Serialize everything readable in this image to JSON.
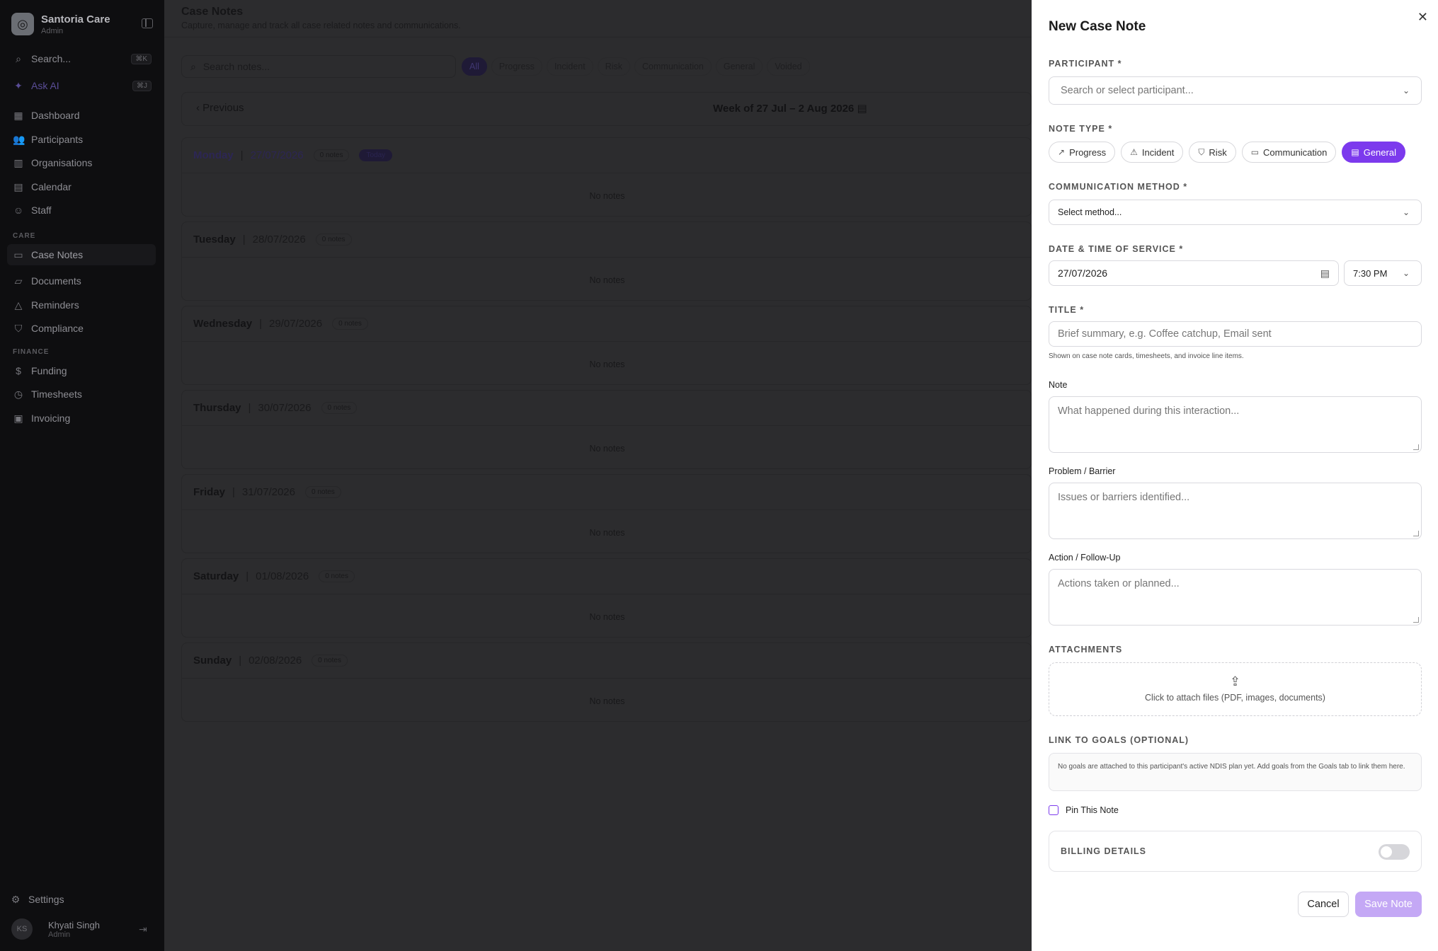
{
  "sidebar": {
    "brand_name": "Santoria Care",
    "brand_role": "Admin",
    "search_label": "Search...",
    "search_kbd": "⌘K",
    "ask_ai_label": "Ask AI",
    "ask_ai_kbd": "⌘J",
    "nav": [
      {
        "label": "Dashboard",
        "icon": "grid-icon"
      },
      {
        "label": "Participants",
        "icon": "users-icon"
      },
      {
        "label": "Organisations",
        "icon": "building-icon"
      },
      {
        "label": "Calendar",
        "icon": "calendar-icon"
      },
      {
        "label": "Staff",
        "icon": "staff-icon"
      }
    ],
    "care_label": "CARE",
    "care": [
      {
        "label": "Case Notes",
        "icon": "notes-icon",
        "active": true
      },
      {
        "label": "Documents",
        "icon": "folder-icon"
      },
      {
        "label": "Reminders",
        "icon": "bell-icon"
      },
      {
        "label": "Compliance",
        "icon": "shield-icon"
      }
    ],
    "finance_label": "FINANCE",
    "finance": [
      {
        "label": "Funding",
        "icon": "dollar-icon"
      },
      {
        "label": "Timesheets",
        "icon": "clock-icon"
      },
      {
        "label": "Invoicing",
        "icon": "invoice-icon"
      }
    ],
    "settings_label": "Settings",
    "user_initials": "KS",
    "user_name": "Khyati Singh",
    "user_role": "Admin"
  },
  "main": {
    "title": "Case Notes",
    "subtitle": "Capture, manage and track all case related notes and communications.",
    "search_placeholder": "Search notes...",
    "filters": [
      "All",
      "Progress",
      "Incident",
      "Risk",
      "Communication",
      "General",
      "Voided"
    ],
    "previous_label": "Previous",
    "week_label": "Week of 27 Jul – 2 Aug 2026",
    "no_notes": "No notes",
    "today_label": "Today",
    "days": [
      {
        "name": "Monday",
        "date": "27/07/2026",
        "count": "0 notes",
        "today": true
      },
      {
        "name": "Tuesday",
        "date": "28/07/2026",
        "count": "0 notes"
      },
      {
        "name": "Wednesday",
        "date": "29/07/2026",
        "count": "0 notes"
      },
      {
        "name": "Thursday",
        "date": "30/07/2026",
        "count": "0 notes"
      },
      {
        "name": "Friday",
        "date": "31/07/2026",
        "count": "0 notes"
      },
      {
        "name": "Saturday",
        "date": "01/08/2026",
        "count": "0 notes"
      },
      {
        "name": "Sunday",
        "date": "02/08/2026",
        "count": "0 notes"
      }
    ]
  },
  "drawer": {
    "title": "New Case Note",
    "participant_label": "PARTICIPANT *",
    "participant_placeholder": "Search or select participant...",
    "note_type_label": "NOTE TYPE *",
    "note_types": [
      {
        "label": "Progress",
        "icon": "trend-icon"
      },
      {
        "label": "Incident",
        "icon": "warning-icon"
      },
      {
        "label": "Risk",
        "icon": "shield-icon"
      },
      {
        "label": "Communication",
        "icon": "chat-icon"
      },
      {
        "label": "General",
        "icon": "document-icon",
        "active": true
      }
    ],
    "comm_method_label": "COMMUNICATION METHOD *",
    "comm_method_value": "Select method...",
    "datetime_label": "DATE & TIME OF SERVICE *",
    "date_value": "27/07/2026",
    "time_value": "7:30 PM",
    "title_label": "TITLE *",
    "title_placeholder": "Brief summary, e.g. Coffee catchup, Email sent",
    "title_helper": "Shown on case note cards, timesheets, and invoice line items.",
    "note_label": "Note",
    "note_placeholder": "What happened during this interaction...",
    "problem_label": "Problem / Barrier",
    "problem_placeholder": "Issues or barriers identified...",
    "action_label": "Action / Follow-Up",
    "action_placeholder": "Actions taken or planned...",
    "attachments_label": "ATTACHMENTS",
    "attach_text": "Click to attach files (PDF, images, documents)",
    "goals_label": "LINK TO GOALS (OPTIONAL)",
    "goals_text": "No goals are attached to this participant's active NDIS plan yet. Add goals from the Goals tab to link them here.",
    "pin_label": "Pin This Note",
    "billing_label": "BILLING DETAILS",
    "billing_enabled": false,
    "cancel_label": "Cancel",
    "save_label": "Save Note",
    "accent_color": "#7c3aed"
  }
}
